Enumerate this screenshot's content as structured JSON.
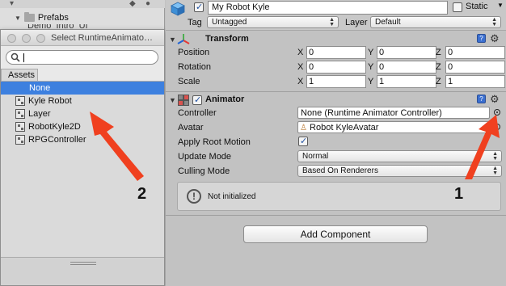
{
  "project": {
    "folder_label": "Prefabs",
    "child_label": "Demo_Intro_UI"
  },
  "dialog": {
    "title": "Select RuntimeAnimato…",
    "search_value": "",
    "tab_label": "Assets",
    "items": [
      {
        "label": "None",
        "selected": true
      },
      {
        "label": "Kyle Robot",
        "selected": false
      },
      {
        "label": "Layer",
        "selected": false
      },
      {
        "label": "RobotKyle2D",
        "selected": false
      },
      {
        "label": "RPGController",
        "selected": false
      }
    ]
  },
  "inspector": {
    "object_name": "My Robot Kyle",
    "active": true,
    "static_label": "Static",
    "static_checked": false,
    "tag_label": "Tag",
    "tag_value": "Untagged",
    "layer_label": "Layer",
    "layer_value": "Default",
    "transform": {
      "title": "Transform",
      "position": {
        "label": "Position",
        "x": "0",
        "y": "0",
        "z": "0"
      },
      "rotation": {
        "label": "Rotation",
        "x": "0",
        "y": "0",
        "z": "0"
      },
      "scale": {
        "label": "Scale",
        "x": "1",
        "y": "1",
        "z": "1"
      },
      "axis_x": "X",
      "axis_y": "Y",
      "axis_z": "Z"
    },
    "animator": {
      "title": "Animator",
      "enabled": true,
      "controller_label": "Controller",
      "controller_value": "None (Runtime Animator Controller)",
      "avatar_label": "Avatar",
      "avatar_value": "Robot KyleAvatar",
      "root_motion_label": "Apply Root Motion",
      "root_motion_checked": true,
      "update_mode_label": "Update Mode",
      "update_mode_value": "Normal",
      "culling_mode_label": "Culling Mode",
      "culling_mode_value": "Based On Renderers",
      "info_text": "Not initialized"
    },
    "add_component_label": "Add Component"
  },
  "annotations": {
    "label_1": "1",
    "label_2": "2",
    "arrow_color": "#f0401f"
  }
}
